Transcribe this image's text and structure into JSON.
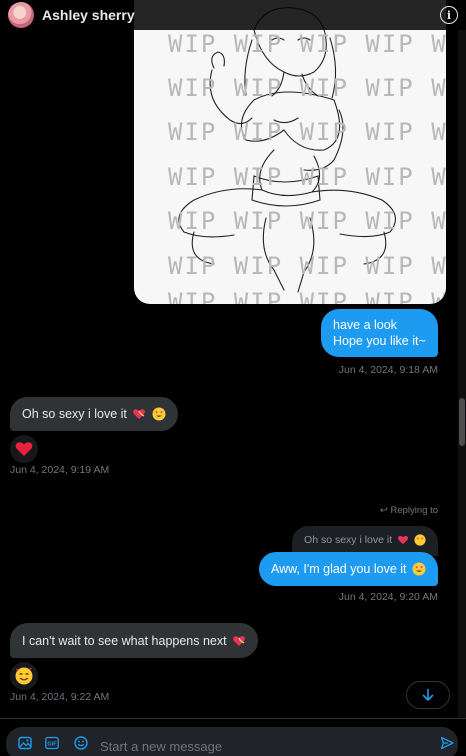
{
  "header": {
    "name": "Ashley sherry"
  },
  "image_message": {
    "watermark": "WIP WIP WIP WIP WIP"
  },
  "messages": [
    {
      "id": "m1",
      "text": "have a look",
      "text2": "Hope you like it~",
      "timestamp": "Jun 4, 2024, 9:18 AM"
    },
    {
      "id": "m2",
      "text": "Oh so sexy i love it",
      "reaction": "heart",
      "timestamp": "Jun 4, 2024, 9:19 AM"
    },
    {
      "id": "m3",
      "reply_label": "Replying to",
      "quote": "Oh so sexy i love it",
      "text": "Aww, I'm glad you love it",
      "timestamp": "Jun 4, 2024, 9:20 AM"
    },
    {
      "id": "m4",
      "text": "I can't wait to see what happens next",
      "reaction": "smiling-face-with-hearts",
      "timestamp": "Jun 4, 2024, 9:22 AM"
    }
  ],
  "composer": {
    "placeholder": "Start a new message",
    "icons": [
      "image-icon",
      "gif-icon",
      "emoji-icon",
      "send-icon"
    ]
  },
  "colors": {
    "background": "#000000",
    "outgoing_bubble": "#1d9bf0",
    "incoming_bubble": "#2f3336",
    "secondary_text": "#71767b"
  }
}
